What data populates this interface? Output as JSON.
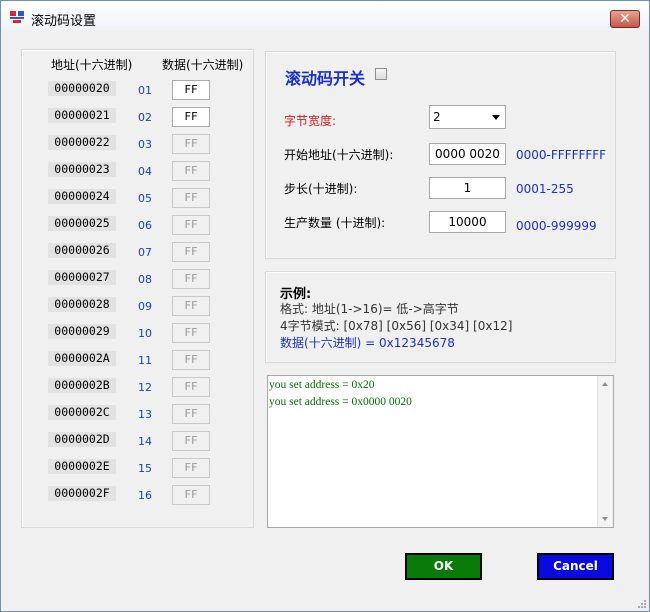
{
  "window": {
    "title": "滚动码设置",
    "close_label": "✕"
  },
  "table": {
    "address_header": "地址(十六进制)",
    "data_header": "数据(十六进制)",
    "rows": [
      {
        "address": "00000020",
        "index": "01",
        "value": "FF",
        "enabled": true
      },
      {
        "address": "00000021",
        "index": "02",
        "value": "FF",
        "enabled": true
      },
      {
        "address": "00000022",
        "index": "03",
        "value": "FF",
        "enabled": false
      },
      {
        "address": "00000023",
        "index": "04",
        "value": "FF",
        "enabled": false
      },
      {
        "address": "00000024",
        "index": "05",
        "value": "FF",
        "enabled": false
      },
      {
        "address": "00000025",
        "index": "06",
        "value": "FF",
        "enabled": false
      },
      {
        "address": "00000026",
        "index": "07",
        "value": "FF",
        "enabled": false
      },
      {
        "address": "00000027",
        "index": "08",
        "value": "FF",
        "enabled": false
      },
      {
        "address": "00000028",
        "index": "09",
        "value": "FF",
        "enabled": false
      },
      {
        "address": "00000029",
        "index": "10",
        "value": "FF",
        "enabled": false
      },
      {
        "address": "0000002A",
        "index": "11",
        "value": "FF",
        "enabled": false
      },
      {
        "address": "0000002B",
        "index": "12",
        "value": "FF",
        "enabled": false
      },
      {
        "address": "0000002C",
        "index": "13",
        "value": "FF",
        "enabled": false
      },
      {
        "address": "0000002D",
        "index": "14",
        "value": "FF",
        "enabled": false
      },
      {
        "address": "0000002E",
        "index": "15",
        "value": "FF",
        "enabled": false
      },
      {
        "address": "0000002F",
        "index": "16",
        "value": "FF",
        "enabled": false
      }
    ]
  },
  "settings": {
    "switch_label": "滚动码开关",
    "switch_checked": false,
    "byte_width_label": "字节宽度:",
    "byte_width_value": "2",
    "start_address_label": "开始地址(十六进制):",
    "start_address_value": "0000 0020",
    "start_address_range": "0000-FFFFFFFF",
    "step_label": "步长(十进制):",
    "step_value": "1",
    "step_range": "0001-255",
    "quantity_label": "生产数量 (十进制):",
    "quantity_value": "10000",
    "quantity_range": "0000-999999"
  },
  "example": {
    "title": "示例:",
    "line1": "格式: 地址(1->16)= 低->高字节",
    "line2": "4字节模式: [0x78] [0x56] [0x34] [0x12]",
    "line3": "数据(十六进制)  =  0x12345678"
  },
  "log": {
    "lines": [
      "you set address = 0x20",
      "you set address = 0x0000 0020"
    ]
  },
  "buttons": {
    "ok": "OK",
    "cancel": "Cancel"
  },
  "colors": {
    "ok": "#0a7a0a",
    "cancel": "#0a0ae0",
    "label_blue": "#1a2fd0",
    "label_red": "#d71c1c",
    "log_text": "#0a6a0a"
  }
}
